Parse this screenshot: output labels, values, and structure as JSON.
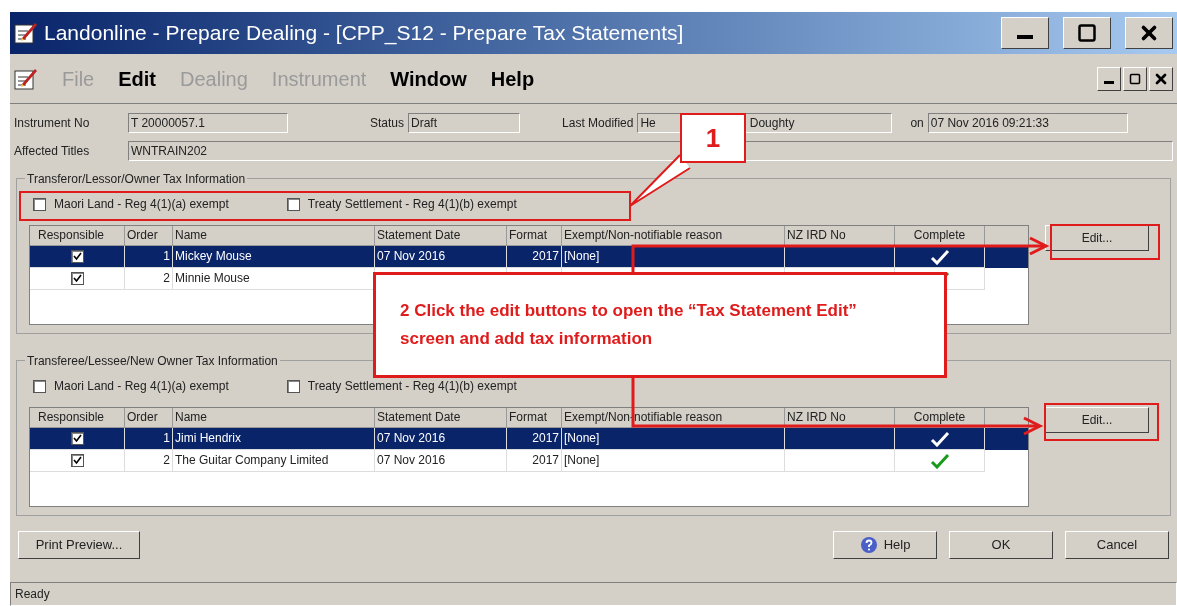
{
  "window": {
    "title": "Landonline - Prepare Dealing - [CPP_S12 - Prepare Tax Statements]"
  },
  "menu": [
    {
      "label": "File",
      "disabled": true
    },
    {
      "label": "Edit",
      "disabled": false
    },
    {
      "label": "Dealing",
      "disabled": true
    },
    {
      "label": "Instrument",
      "disabled": true
    },
    {
      "label": "Window",
      "disabled": false
    },
    {
      "label": "Help",
      "disabled": false
    }
  ],
  "header_fields": {
    "instrument_no": {
      "label": "Instrument No",
      "value": "T 20000057.1"
    },
    "status": {
      "label": "Status",
      "value": "Draft"
    },
    "last_modified": {
      "label": "Last Modified",
      "value_parts": [
        "He",
        "Doughty"
      ]
    },
    "on": {
      "label": "on",
      "value": "07 Nov 2016 09:21:33"
    },
    "affected_titles": {
      "label": "Affected Titles",
      "value": "WNTRAIN202"
    }
  },
  "sections": [
    {
      "title": "Transferor/Lessor/Owner Tax Information",
      "exemptions": [
        {
          "label": "Maori Land - Reg 4(1)(a) exempt",
          "checked": false
        },
        {
          "label": "Treaty Settlement - Reg 4(1)(b) exempt",
          "checked": false
        }
      ],
      "columns": [
        "Responsible",
        "Order",
        "Name",
        "Statement Date",
        "Format",
        "Exempt/Non-notifiable reason",
        "NZ IRD No",
        "Complete"
      ],
      "rows": [
        {
          "responsible": true,
          "order": "1",
          "name": "Mickey Mouse",
          "statement_date": "07 Nov 2016",
          "format": "2017",
          "reason": "[None]",
          "complete": true,
          "selected": true
        },
        {
          "responsible": true,
          "order": "2",
          "name": "Minnie Mouse",
          "complete": true,
          "selected": false
        }
      ],
      "edit_button": "Edit..."
    },
    {
      "title": "Transferee/Lessee/New Owner Tax Information",
      "exemptions": [
        {
          "label": "Maori Land - Reg 4(1)(a) exempt",
          "checked": false
        },
        {
          "label": "Treaty Settlement - Reg 4(1)(b) exempt",
          "checked": false
        }
      ],
      "columns": [
        "Responsible",
        "Order",
        "Name",
        "Statement Date",
        "Format",
        "Exempt/Non-notifiable reason",
        "NZ IRD No",
        "Complete"
      ],
      "rows": [
        {
          "responsible": true,
          "order": "1",
          "name": "Jimi Hendrix",
          "statement_date": "07 Nov 2016",
          "format": "2017",
          "reason": "[None]",
          "complete": true,
          "selected": true
        },
        {
          "responsible": true,
          "order": "2",
          "name": "The Guitar Company Limited",
          "statement_date": "07 Nov 2016",
          "format": "2017",
          "reason": "[None]",
          "complete": true,
          "selected": false
        }
      ],
      "edit_button": "Edit..."
    }
  ],
  "buttons": {
    "print_preview": "Print Preview...",
    "help": "Help",
    "ok": "OK",
    "cancel": "Cancel"
  },
  "status_bar": "Ready",
  "callouts": [
    {
      "label": "1"
    },
    {
      "label": "2 Click the edit buttons to open the “Tax Statement Edit” screen and add tax information"
    }
  ]
}
